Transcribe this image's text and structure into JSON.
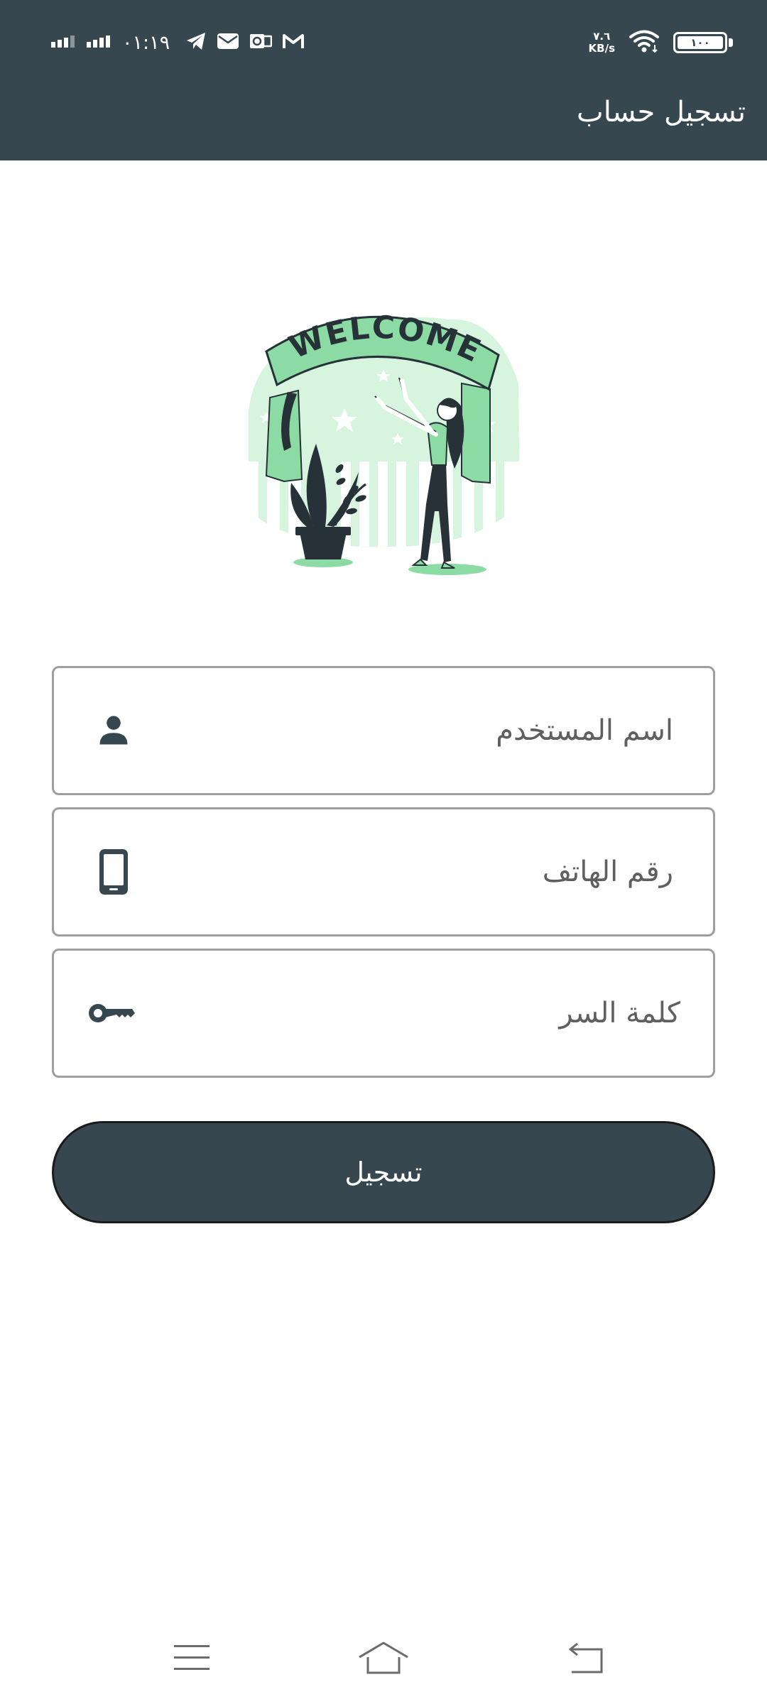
{
  "status_bar": {
    "time": "٠١:١٩",
    "net_speed_value": "٧.٦",
    "net_speed_unit": "KB/s",
    "battery_level": "١٠٠",
    "icons_left": [
      "signal-icon",
      "signal-icon",
      "telegram-icon",
      "mail-icon",
      "outlook-icon",
      "gmail-icon"
    ],
    "icons_right": [
      "wifi-icon",
      "battery-icon"
    ]
  },
  "app_bar": {
    "title": "تسجيل حساب"
  },
  "form": {
    "username_placeholder": "اسم المستخدم",
    "phone_placeholder": "رقم الهاتف",
    "password_placeholder": "كلمة السر",
    "submit_label": "تسجيل"
  },
  "illustration": {
    "banner_text": "WELCOME"
  },
  "nav_bar": {
    "icons": [
      "menu-icon",
      "home-icon",
      "back-icon"
    ]
  },
  "colors": {
    "primary": "#37474f",
    "accent_green": "#8ddba4",
    "light_green": "#d7f4df",
    "field_border": "#9e9e9e"
  }
}
